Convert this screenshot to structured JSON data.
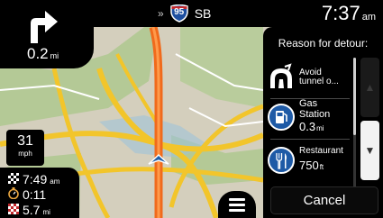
{
  "top_bar": {
    "chevron": "»",
    "route_number": "95",
    "direction": "SB",
    "time": "7:37",
    "time_period": "am"
  },
  "turn": {
    "icon": "turn-right-arrow-icon",
    "distance": "0.2",
    "unit": "mi"
  },
  "speed": {
    "value": "31",
    "unit": "mph"
  },
  "trip": {
    "arrival_time": "7:49",
    "arrival_period": "am",
    "remaining_time": "0:11",
    "remaining_distance": "5.7",
    "remaining_distance_unit": "mi"
  },
  "detour": {
    "title": "Reason for detour:",
    "items": [
      {
        "icon": "tunnel-icon",
        "line1": "Avoid",
        "line2": "tunnel o..."
      },
      {
        "icon": "gas-pump-icon",
        "line1": "Gas",
        "line2": "Station",
        "distance": "0.3",
        "unit": "mi"
      },
      {
        "icon": "fork-knife-icon",
        "line1": "Restaurant",
        "distance": "750",
        "unit": "ft"
      }
    ],
    "scroll_up_glyph": "▲",
    "scroll_down_glyph": "▼",
    "cancel_label": "Cancel"
  },
  "colors": {
    "map_background": "#d4cfbd",
    "route": "#f06a1c",
    "highway": "#f2c52b",
    "panel": "#000000",
    "position_marker": "#1f5ea8",
    "icon_blue": "#1e5aa6"
  }
}
